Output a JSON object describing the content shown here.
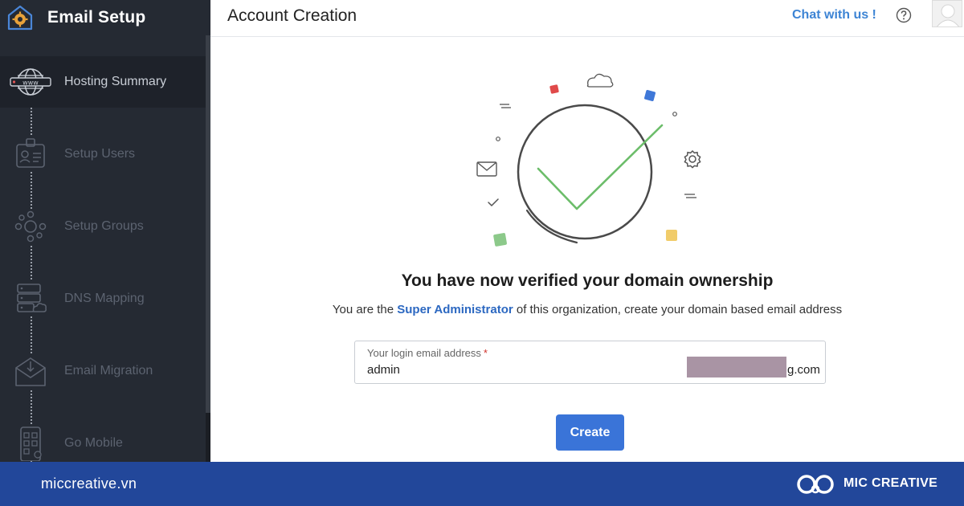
{
  "sidebar": {
    "title": "Email Setup",
    "items": [
      {
        "label": "Hosting Summary",
        "icon": "globe-www-icon",
        "active": true
      },
      {
        "label": "Setup Users",
        "icon": "user-id-card-icon"
      },
      {
        "label": "Setup Groups",
        "icon": "group-network-icon"
      },
      {
        "label": "DNS Mapping",
        "icon": "server-cloud-icon"
      },
      {
        "label": "Email Migration",
        "icon": "envelope-download-icon"
      },
      {
        "label": "Go Mobile",
        "icon": "mobile-grid-icon"
      }
    ]
  },
  "header": {
    "title": "Account Creation",
    "chat_label": "Chat with us !"
  },
  "main": {
    "headline": "You have now verified your domain ownership",
    "subline_prefix": "You are the ",
    "subline_highlight": "Super Administrator",
    "subline_suffix": " of this organization, create your domain based email address",
    "email_label": "Your login email address",
    "email_required": "*",
    "email_value": "admin",
    "email_domain": "g.com",
    "create_label": "Create"
  },
  "footer": {
    "site": "miccreative.vn",
    "brand": "MIC CREATIVE"
  },
  "colors": {
    "sidebar_bg": "#252a33",
    "accent_blue": "#3a74d8",
    "link_blue": "#2c68c1",
    "check_green": "#6cbd6a",
    "footer_bg": "#22479a"
  }
}
